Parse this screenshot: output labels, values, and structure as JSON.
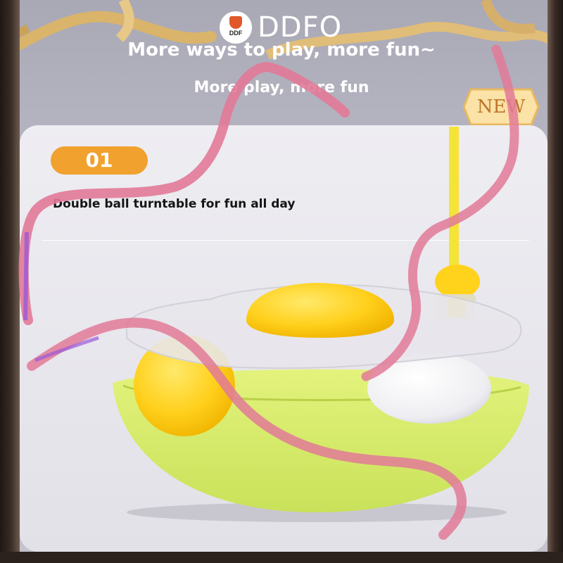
{
  "brand": {
    "logo_text": "DDF",
    "name": "DDFO"
  },
  "header": {
    "tagline": "More ways to play, more fun~",
    "subtitle": "More play, more fun"
  },
  "badge": {
    "label": "NEW"
  },
  "feature": {
    "number": "01",
    "title": "Double ball turntable for fun all day"
  },
  "colors": {
    "accent": "#f0a12e",
    "ribbon": "#e27a98",
    "toy_base": "#d4ec6a",
    "ball_yellow": "#ffd61f"
  }
}
